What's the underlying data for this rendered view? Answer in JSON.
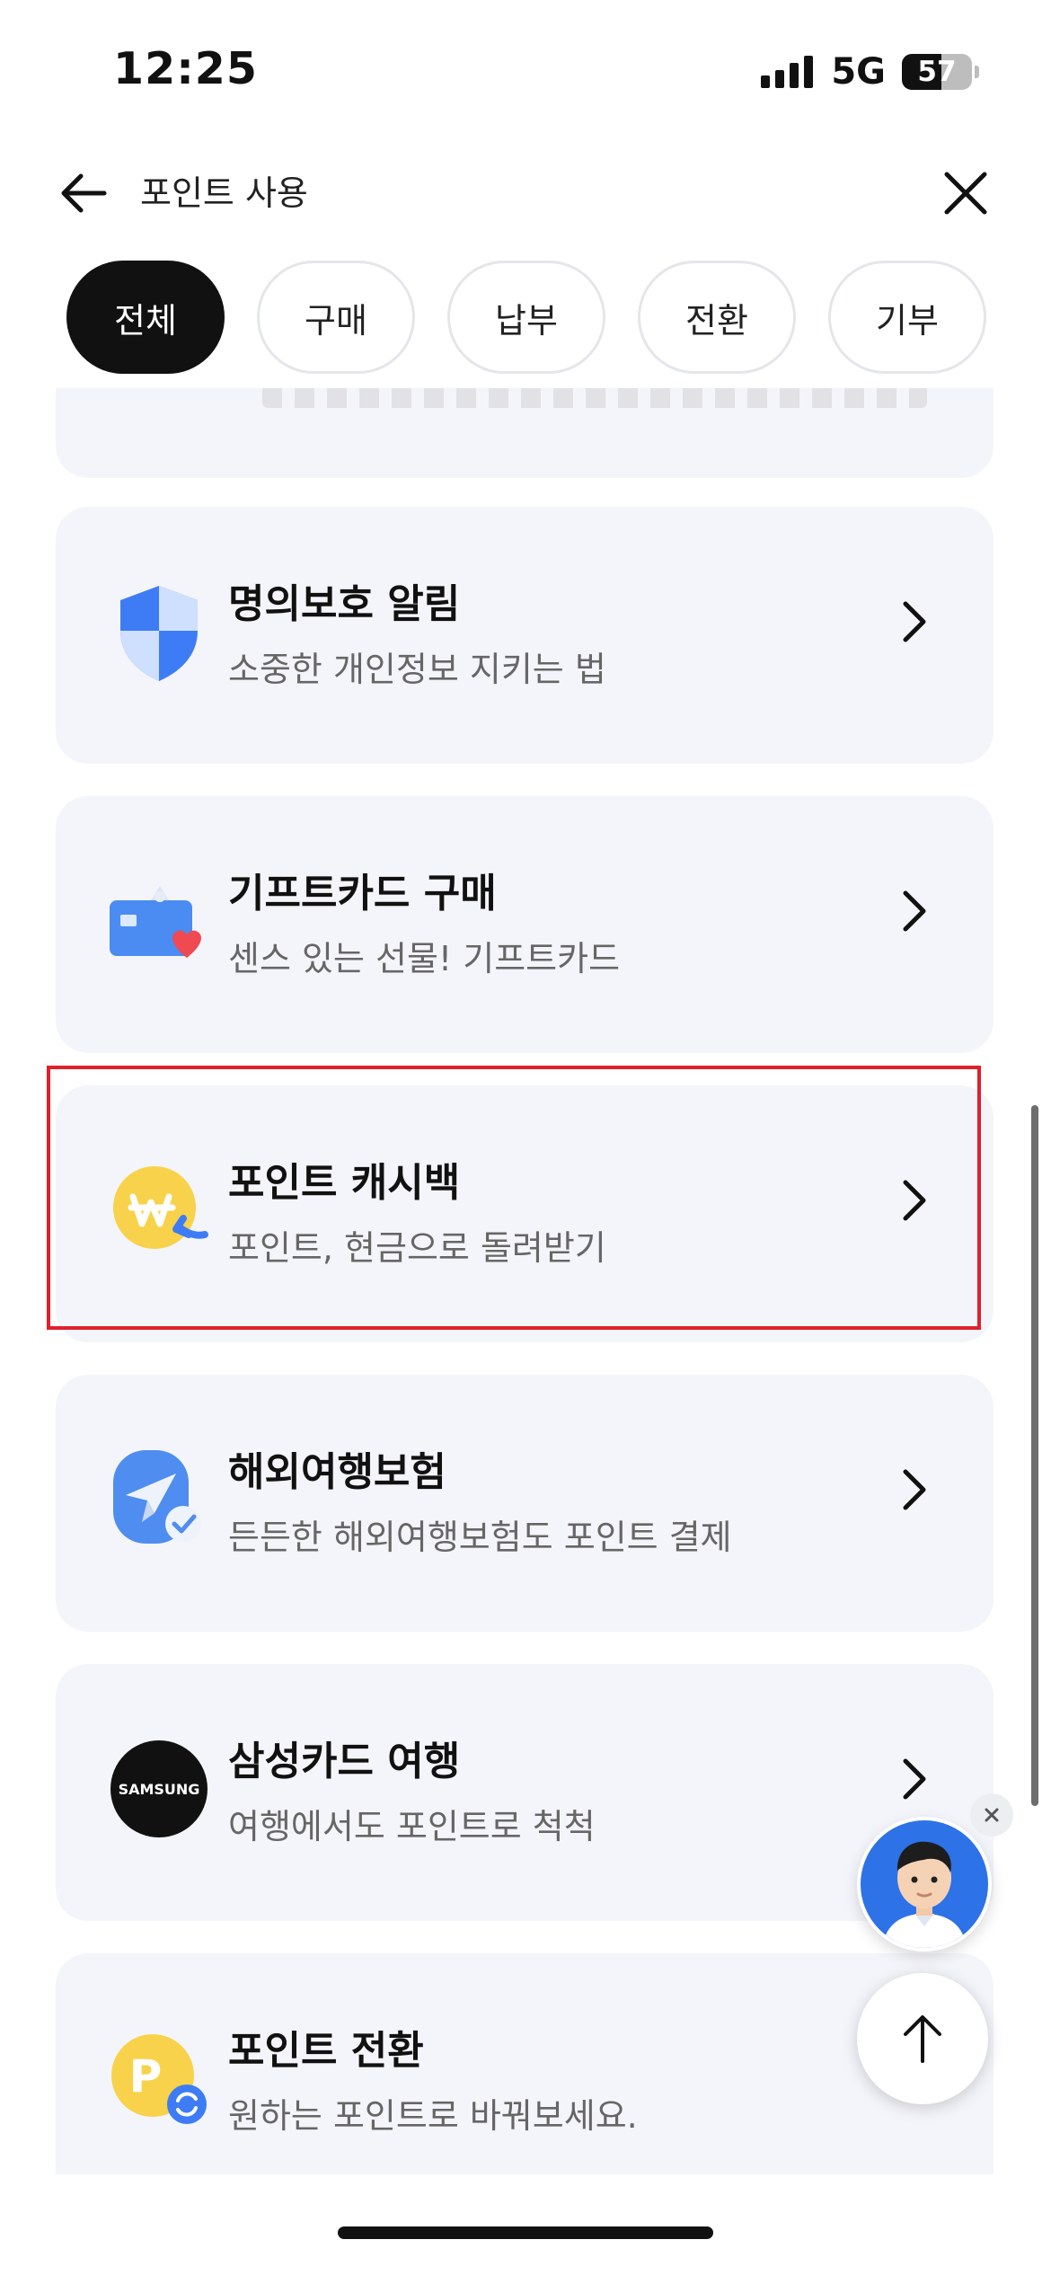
{
  "status": {
    "time": "12:25",
    "network": "5G",
    "battery": "57"
  },
  "header": {
    "title": "포인트 사용"
  },
  "tabs": [
    "전체",
    "구매",
    "납부",
    "전환",
    "기부"
  ],
  "cards": [
    {
      "title": "명의보호 알림",
      "subtitle": "소중한 개인정보 지키는 법",
      "icon": "shield-icon"
    },
    {
      "title": "기프트카드 구매",
      "subtitle": "센스 있는 선물! 기프트카드",
      "icon": "gift-card-icon"
    },
    {
      "title": "포인트 캐시백",
      "subtitle": "포인트, 현금으로 돌려받기",
      "icon": "won-cashback-icon",
      "highlighted": true
    },
    {
      "title": "해외여행보험",
      "subtitle": "든든한 해외여행보험도 포인트 결제",
      "icon": "travel-insurance-icon"
    },
    {
      "title": "삼성카드 여행",
      "subtitle": "여행에서도 포인트로 척척",
      "icon": "samsung-logo-icon",
      "logo_text": "SAMSUNG"
    },
    {
      "title": "포인트 전환",
      "subtitle": "원하는 포인트로 바꿔보세요.",
      "icon": "point-exchange-icon",
      "logo_text": "P"
    }
  ],
  "colors": {
    "accent": "#111111",
    "card_bg": "#f4f5fa",
    "highlight_border": "#e0202c",
    "avatar_bg": "#2d72e6"
  }
}
